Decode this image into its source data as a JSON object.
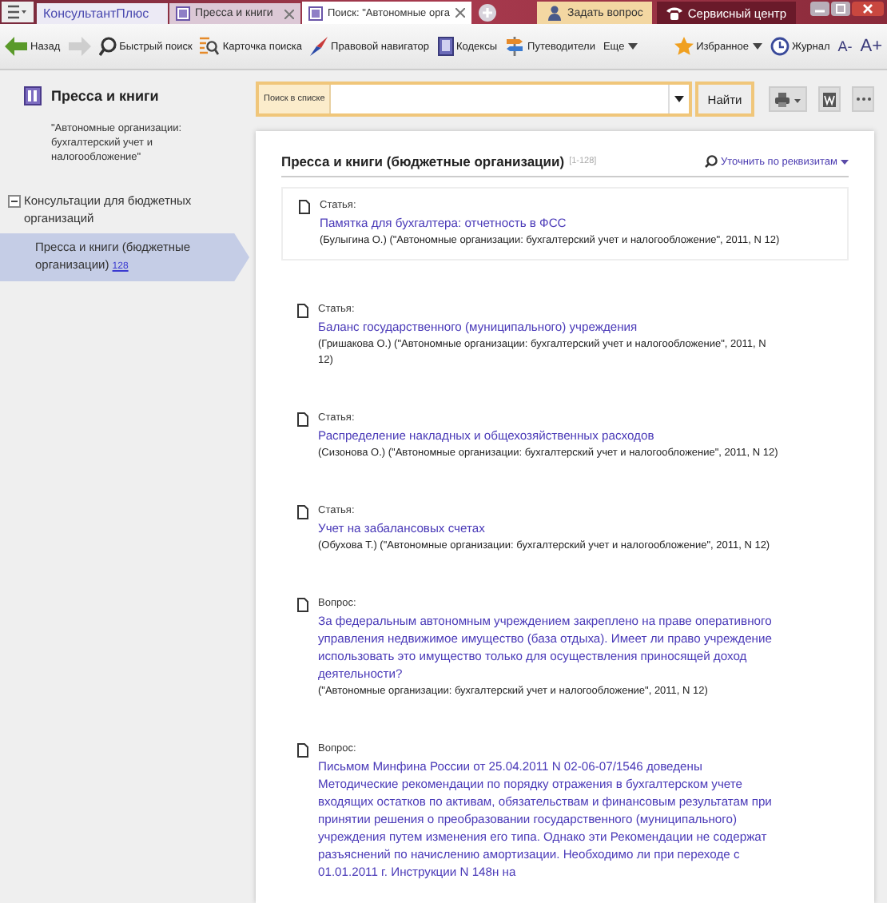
{
  "tabbar": {
    "tabs": [
      {
        "label": "КонсультантПлюс",
        "kind": "logo",
        "selected": false
      },
      {
        "label": "Пресса и книги",
        "kind": "doc",
        "selected": false
      },
      {
        "label": "Поиск: \"Автономные орга",
        "kind": "search",
        "selected": true
      }
    ],
    "ask_button": "Задать вопрос",
    "service_button": "Сервисный центр"
  },
  "toolbar": {
    "items": [
      {
        "label": "Назад",
        "kind": "back",
        "disabled": false
      },
      {
        "kind": "forward",
        "disabled": true
      },
      {
        "label": "Быстрый поиск",
        "kind": "quick",
        "disabled": false
      },
      {
        "label": "Карточка поиска",
        "kind": "card",
        "disabled": false
      },
      {
        "label": "Правовой навигатор",
        "kind": "nav",
        "disabled": false
      },
      {
        "label": "Кодексы",
        "kind": "codes",
        "disabled": false
      },
      {
        "label": "Путеводители",
        "kind": "guides",
        "disabled": false
      },
      {
        "label": "Еще",
        "kind": "more",
        "disabled": false
      }
    ],
    "favorites": "Избранное",
    "journal": "Журнал",
    "font_smaller": "A-",
    "font_larger": "A+"
  },
  "sidebar": {
    "title": "Пресса и книги",
    "subtitle": "\"Автономные организации: бухгалтерский учет и налогообложение\"",
    "tree": [
      {
        "label": "Консультации для бюджетных организаций",
        "expanded": true,
        "children": [
          {
            "label": "Пресса и книги (бюджетные организации)",
            "count": "128",
            "selected": true
          }
        ]
      }
    ]
  },
  "search": {
    "label": "Поиск в списке",
    "button": "Найти"
  },
  "list": {
    "title": "Пресса и книги (бюджетные организации)",
    "range": "[1-128]",
    "refine": "Уточнить по реквизитам",
    "items": [
      {
        "type": "Статья:",
        "title": "Памятка для бухгалтера: отчетность в ФСС",
        "source": "(Булыгина О.) (\"Автономные организации: бухгалтерский учет и налогообложение\", 2011, N 12)",
        "selected": true
      },
      {
        "type": "Статья:",
        "title": "Баланс государственного (муниципального) учреждения",
        "source": "(Гришакова О.) (\"Автономные организации: бухгалтерский учет и налогообложение\", 2011, N 12)",
        "selected": false
      },
      {
        "type": "Статья:",
        "title": "Распределение накладных и общехозяйственных расходов",
        "source": "(Сизонова О.) (\"Автономные организации: бухгалтерский учет и налогообложение\", 2011, N 12)",
        "selected": false
      },
      {
        "type": "Статья:",
        "title": "Учет на забалансовых счетах",
        "source": "(Обухова Т.) (\"Автономные организации: бухгалтерский учет и налогообложение\", 2011, N 12)",
        "selected": false
      },
      {
        "type": "Вопрос:",
        "title": "За федеральным автономным учреждением закреплено на праве оперативного управления недвижимое имущество (база отдыха). Имеет ли право учреждение использовать это имущество только для осуществления приносящей доход деятельности?",
        "source": "(\"Автономные организации: бухгалтерский учет и налогообложение\", 2011, N 12)",
        "selected": false
      },
      {
        "type": "Вопрос:",
        "title": "Письмом Минфина России от 25.04.2011 N 02-06-07/1546 доведены Методические рекомендации по порядку отражения в бухгалтерском учете входящих остатков по активам, обязательствам и финансовым результатам при принятии решения о преобразовании государственного (муниципального) учреждения путем изменения его типа. Однако эти Рекомендации не содержат разъяснений по начислению амортизации. Необходимо ли при переходе с 01.01.2011 г. Инструкции N 148н на",
        "selected": false
      }
    ]
  }
}
